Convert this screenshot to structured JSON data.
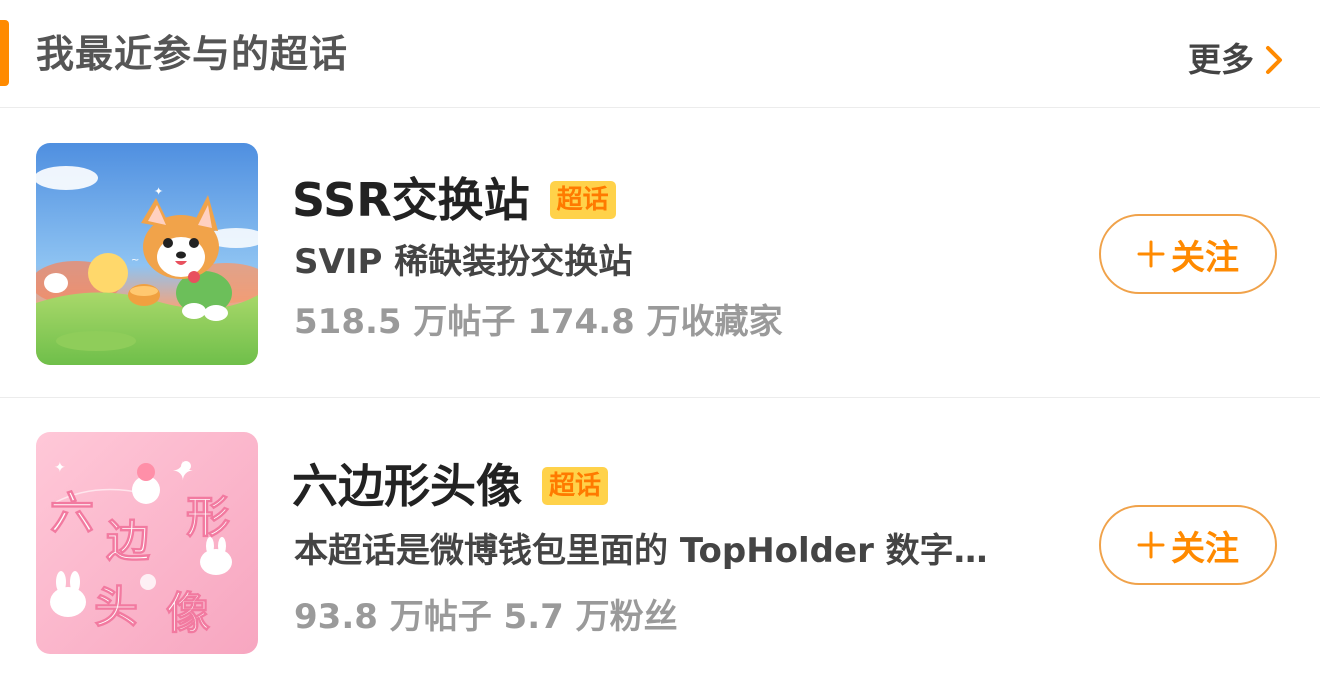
{
  "header": {
    "title": "我最近参与的超话",
    "more_label": "更多",
    "accent_color": "#ff8a00"
  },
  "topics": [
    {
      "name": "SSR交换站",
      "badge": "超话",
      "description": "SVIP 稀缺装扮交换站",
      "stats": "518.5 万帖子 174.8 万收藏家",
      "follow_label": "关注",
      "thumbnail": "corgi-illustration"
    },
    {
      "name": "六边形头像",
      "badge": "超话",
      "description": "本超话是微博钱包里面的 TopHolder 数字…",
      "stats": "93.8 万帖子 5.7 万粉丝",
      "follow_label": "关注",
      "thumbnail": "pink-bunny-illustration",
      "thumbnail_text": [
        "六",
        "边",
        "形",
        "头",
        "像"
      ]
    }
  ],
  "icons": {
    "more": "chevron-right-icon",
    "follow": "plus-icon"
  },
  "colors": {
    "badge_bg": "#ffd24a",
    "badge_text": "#ff7a00",
    "follow_border": "#f0a24a",
    "follow_text": "#ff8a00"
  }
}
